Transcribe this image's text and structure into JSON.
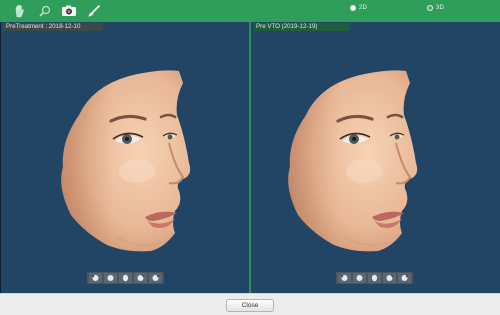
{
  "toolbar": {
    "tools": [
      "hand-tool",
      "zoom-tool",
      "camera-tool",
      "brush-tool"
    ],
    "view_mode": {
      "options": [
        "2D",
        "3D"
      ],
      "selected": "3D"
    },
    "accent_color": "#2f9e5a"
  },
  "panels": [
    {
      "tag": "PreTreatment : 2018-12-10"
    },
    {
      "tag": "Pre VTO (2019-12-19)"
    }
  ],
  "view_buttons": [
    "rotate-left-icon",
    "face-front-icon",
    "face-side-icon",
    "face-tilt-icon",
    "rotate-right-icon"
  ],
  "footer": {
    "close_label": "Close"
  },
  "colors": {
    "viewport_bg": "#234565",
    "divider": "#2c8f58"
  }
}
